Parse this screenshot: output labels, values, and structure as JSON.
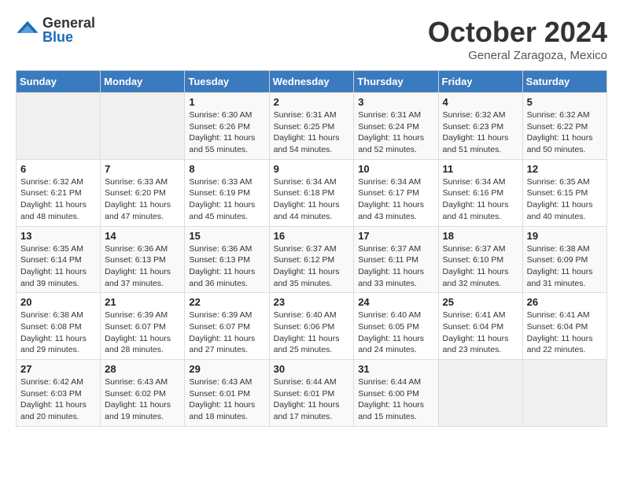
{
  "logo": {
    "general": "General",
    "blue": "Blue"
  },
  "header": {
    "month": "October 2024",
    "location": "General Zaragoza, Mexico"
  },
  "days_of_week": [
    "Sunday",
    "Monday",
    "Tuesday",
    "Wednesday",
    "Thursday",
    "Friday",
    "Saturday"
  ],
  "weeks": [
    [
      {
        "day": "",
        "sunrise": "",
        "sunset": "",
        "daylight": ""
      },
      {
        "day": "",
        "sunrise": "",
        "sunset": "",
        "daylight": ""
      },
      {
        "day": "1",
        "sunrise": "Sunrise: 6:30 AM",
        "sunset": "Sunset: 6:26 PM",
        "daylight": "Daylight: 11 hours and 55 minutes."
      },
      {
        "day": "2",
        "sunrise": "Sunrise: 6:31 AM",
        "sunset": "Sunset: 6:25 PM",
        "daylight": "Daylight: 11 hours and 54 minutes."
      },
      {
        "day": "3",
        "sunrise": "Sunrise: 6:31 AM",
        "sunset": "Sunset: 6:24 PM",
        "daylight": "Daylight: 11 hours and 52 minutes."
      },
      {
        "day": "4",
        "sunrise": "Sunrise: 6:32 AM",
        "sunset": "Sunset: 6:23 PM",
        "daylight": "Daylight: 11 hours and 51 minutes."
      },
      {
        "day": "5",
        "sunrise": "Sunrise: 6:32 AM",
        "sunset": "Sunset: 6:22 PM",
        "daylight": "Daylight: 11 hours and 50 minutes."
      }
    ],
    [
      {
        "day": "6",
        "sunrise": "Sunrise: 6:32 AM",
        "sunset": "Sunset: 6:21 PM",
        "daylight": "Daylight: 11 hours and 48 minutes."
      },
      {
        "day": "7",
        "sunrise": "Sunrise: 6:33 AM",
        "sunset": "Sunset: 6:20 PM",
        "daylight": "Daylight: 11 hours and 47 minutes."
      },
      {
        "day": "8",
        "sunrise": "Sunrise: 6:33 AM",
        "sunset": "Sunset: 6:19 PM",
        "daylight": "Daylight: 11 hours and 45 minutes."
      },
      {
        "day": "9",
        "sunrise": "Sunrise: 6:34 AM",
        "sunset": "Sunset: 6:18 PM",
        "daylight": "Daylight: 11 hours and 44 minutes."
      },
      {
        "day": "10",
        "sunrise": "Sunrise: 6:34 AM",
        "sunset": "Sunset: 6:17 PM",
        "daylight": "Daylight: 11 hours and 43 minutes."
      },
      {
        "day": "11",
        "sunrise": "Sunrise: 6:34 AM",
        "sunset": "Sunset: 6:16 PM",
        "daylight": "Daylight: 11 hours and 41 minutes."
      },
      {
        "day": "12",
        "sunrise": "Sunrise: 6:35 AM",
        "sunset": "Sunset: 6:15 PM",
        "daylight": "Daylight: 11 hours and 40 minutes."
      }
    ],
    [
      {
        "day": "13",
        "sunrise": "Sunrise: 6:35 AM",
        "sunset": "Sunset: 6:14 PM",
        "daylight": "Daylight: 11 hours and 39 minutes."
      },
      {
        "day": "14",
        "sunrise": "Sunrise: 6:36 AM",
        "sunset": "Sunset: 6:13 PM",
        "daylight": "Daylight: 11 hours and 37 minutes."
      },
      {
        "day": "15",
        "sunrise": "Sunrise: 6:36 AM",
        "sunset": "Sunset: 6:13 PM",
        "daylight": "Daylight: 11 hours and 36 minutes."
      },
      {
        "day": "16",
        "sunrise": "Sunrise: 6:37 AM",
        "sunset": "Sunset: 6:12 PM",
        "daylight": "Daylight: 11 hours and 35 minutes."
      },
      {
        "day": "17",
        "sunrise": "Sunrise: 6:37 AM",
        "sunset": "Sunset: 6:11 PM",
        "daylight": "Daylight: 11 hours and 33 minutes."
      },
      {
        "day": "18",
        "sunrise": "Sunrise: 6:37 AM",
        "sunset": "Sunset: 6:10 PM",
        "daylight": "Daylight: 11 hours and 32 minutes."
      },
      {
        "day": "19",
        "sunrise": "Sunrise: 6:38 AM",
        "sunset": "Sunset: 6:09 PM",
        "daylight": "Daylight: 11 hours and 31 minutes."
      }
    ],
    [
      {
        "day": "20",
        "sunrise": "Sunrise: 6:38 AM",
        "sunset": "Sunset: 6:08 PM",
        "daylight": "Daylight: 11 hours and 29 minutes."
      },
      {
        "day": "21",
        "sunrise": "Sunrise: 6:39 AM",
        "sunset": "Sunset: 6:07 PM",
        "daylight": "Daylight: 11 hours and 28 minutes."
      },
      {
        "day": "22",
        "sunrise": "Sunrise: 6:39 AM",
        "sunset": "Sunset: 6:07 PM",
        "daylight": "Daylight: 11 hours and 27 minutes."
      },
      {
        "day": "23",
        "sunrise": "Sunrise: 6:40 AM",
        "sunset": "Sunset: 6:06 PM",
        "daylight": "Daylight: 11 hours and 25 minutes."
      },
      {
        "day": "24",
        "sunrise": "Sunrise: 6:40 AM",
        "sunset": "Sunset: 6:05 PM",
        "daylight": "Daylight: 11 hours and 24 minutes."
      },
      {
        "day": "25",
        "sunrise": "Sunrise: 6:41 AM",
        "sunset": "Sunset: 6:04 PM",
        "daylight": "Daylight: 11 hours and 23 minutes."
      },
      {
        "day": "26",
        "sunrise": "Sunrise: 6:41 AM",
        "sunset": "Sunset: 6:04 PM",
        "daylight": "Daylight: 11 hours and 22 minutes."
      }
    ],
    [
      {
        "day": "27",
        "sunrise": "Sunrise: 6:42 AM",
        "sunset": "Sunset: 6:03 PM",
        "daylight": "Daylight: 11 hours and 20 minutes."
      },
      {
        "day": "28",
        "sunrise": "Sunrise: 6:43 AM",
        "sunset": "Sunset: 6:02 PM",
        "daylight": "Daylight: 11 hours and 19 minutes."
      },
      {
        "day": "29",
        "sunrise": "Sunrise: 6:43 AM",
        "sunset": "Sunset: 6:01 PM",
        "daylight": "Daylight: 11 hours and 18 minutes."
      },
      {
        "day": "30",
        "sunrise": "Sunrise: 6:44 AM",
        "sunset": "Sunset: 6:01 PM",
        "daylight": "Daylight: 11 hours and 17 minutes."
      },
      {
        "day": "31",
        "sunrise": "Sunrise: 6:44 AM",
        "sunset": "Sunset: 6:00 PM",
        "daylight": "Daylight: 11 hours and 15 minutes."
      },
      {
        "day": "",
        "sunrise": "",
        "sunset": "",
        "daylight": ""
      },
      {
        "day": "",
        "sunrise": "",
        "sunset": "",
        "daylight": ""
      }
    ]
  ]
}
